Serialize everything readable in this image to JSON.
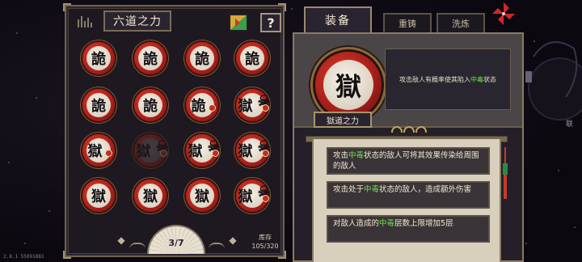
{
  "left_panel": {
    "title": "六道之力",
    "help_label": "?",
    "runes": [
      {
        "glyph": "詭",
        "badge": "",
        "skull": false,
        "dim": false
      },
      {
        "glyph": "詭",
        "badge": "",
        "skull": false,
        "dim": false
      },
      {
        "glyph": "詭",
        "badge": "",
        "skull": false,
        "dim": false
      },
      {
        "glyph": "詭",
        "badge": "",
        "skull": false,
        "dim": false
      },
      {
        "glyph": "詭",
        "badge": "",
        "skull": false,
        "dim": false
      },
      {
        "glyph": "詭",
        "badge": "",
        "skull": false,
        "dim": false
      },
      {
        "glyph": "詭",
        "badge": "",
        "skull": false,
        "dim": false
      },
      {
        "glyph": "獄",
        "badge": "",
        "skull": true,
        "dim": false
      },
      {
        "glyph": "獄",
        "badge": "",
        "skull": false,
        "dim": false
      },
      {
        "glyph": "獄",
        "badge": "",
        "skull": true,
        "dim": true
      },
      {
        "glyph": "獄",
        "badge": "",
        "skull": true,
        "dim": false
      },
      {
        "glyph": "獄",
        "badge": "",
        "skull": true,
        "dim": false
      },
      {
        "glyph": "獄",
        "badge": "",
        "skull": false,
        "dim": false
      },
      {
        "glyph": "獄",
        "badge": "",
        "skull": false,
        "dim": false
      },
      {
        "glyph": "獄",
        "badge": "",
        "skull": false,
        "dim": false
      },
      {
        "glyph": "獄",
        "badge": "",
        "skull": true,
        "dim": false
      }
    ],
    "page_indicator": "3/7",
    "inventory_label": "库存",
    "inventory_count": "105/320"
  },
  "right_panel": {
    "tabs": [
      {
        "label": "装备",
        "active": true
      },
      {
        "label": "重铸",
        "active": false
      },
      {
        "label": "洗炼",
        "active": false
      }
    ],
    "selected_rune_glyph": "獄",
    "selected_rune_name": "獄道之力",
    "effect_prefix": "攻击敌人有概率使其陷入",
    "effect_highlight": "中毒",
    "effect_suffix": "状态",
    "perks": [
      {
        "prefix": "攻击",
        "highlight": "中毒",
        "suffix": "状态的敌人可将其效果传染给周围的敌人"
      },
      {
        "prefix": "攻击处于",
        "highlight": "中毒",
        "suffix": "状态的敌人，造成额外伤害"
      },
      {
        "prefix": "对敌人造成的",
        "highlight": "中毒",
        "suffix": "层数上限增加5层"
      }
    ]
  },
  "background": {
    "side_text": "联",
    "version": "2.8.1 55091881"
  },
  "colors": {
    "highlight": "#6ee044",
    "rune_red": "#b0221a",
    "frame_gold": "#a8946c",
    "panel_bg": "#1e1920"
  },
  "icons": {
    "shuffle": "shuffle-icon",
    "help": "help-icon",
    "close": "pinwheel-close-icon",
    "prev": "chevron-left-icon",
    "next": "chevron-right-icon"
  }
}
